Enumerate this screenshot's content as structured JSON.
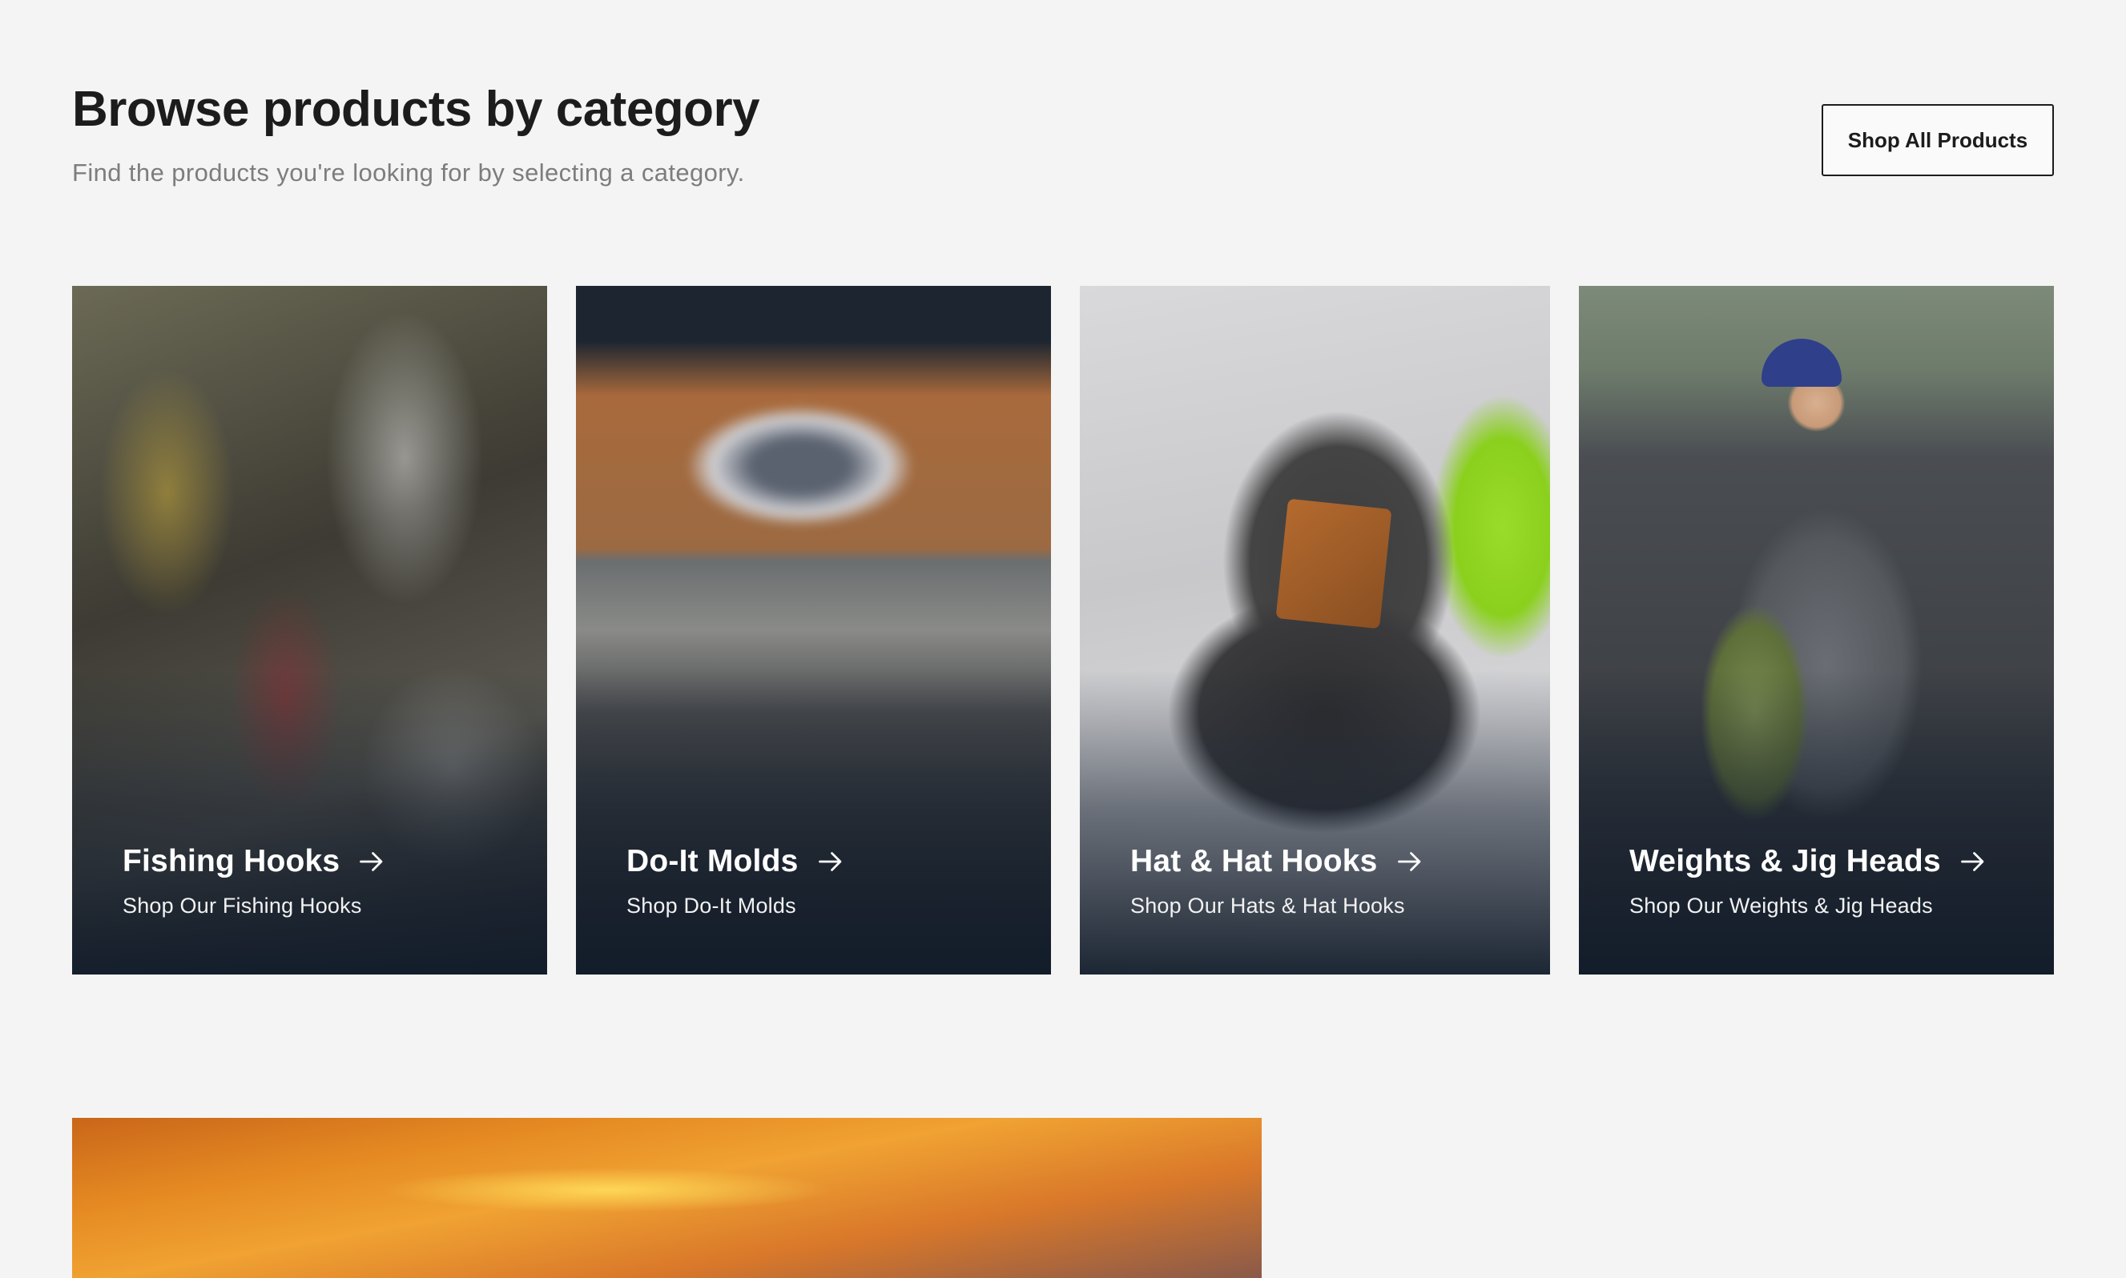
{
  "header": {
    "title": "Browse products by category",
    "subtitle": "Find the products you're looking for by selecting a category.",
    "shop_all_label": "Shop All Products"
  },
  "categories": [
    {
      "title": "Fishing Hooks",
      "subtitle": "Shop Our Fishing Hooks",
      "icon": "arrow-right-icon"
    },
    {
      "title": "Do-It Molds",
      "subtitle": "Shop Do-It Molds",
      "icon": "arrow-right-icon"
    },
    {
      "title": "Hat & Hat Hooks",
      "subtitle": "Shop Our Hats & Hat Hooks",
      "icon": "arrow-right-icon"
    },
    {
      "title": "Weights & Jig Heads",
      "subtitle": "Shop Our Weights & Jig Heads",
      "icon": "arrow-right-icon"
    }
  ],
  "colors": {
    "background": "#f4f4f4",
    "title_text": "#1c1c1c",
    "subtitle_text": "#7d7d7d",
    "card_text": "#ffffff"
  }
}
